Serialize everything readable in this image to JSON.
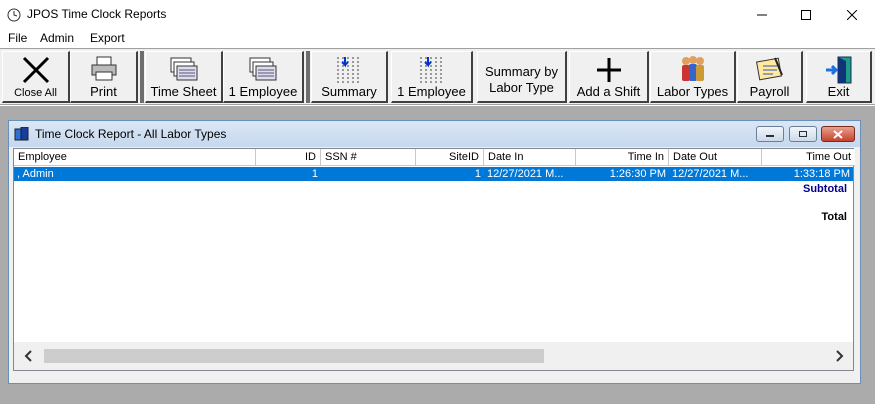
{
  "window": {
    "title": "JPOS Time Clock Reports"
  },
  "menu": [
    "File",
    "Admin",
    "Export"
  ],
  "toolbar": {
    "close_all": "Close All",
    "print": "Print",
    "time_sheet": "Time Sheet",
    "one_employee_a": "1 Employee",
    "summary": "Summary",
    "one_employee_b": "1 Employee",
    "summary_by_labor_type": "Summary by\nLabor Type",
    "add_shift": "Add a Shift",
    "labor_types": "Labor Types",
    "payroll": "Payroll",
    "exit": "Exit"
  },
  "report": {
    "title": "Time Clock Report - All Labor Types",
    "columns": [
      "Employee",
      "ID",
      "SSN #",
      "SiteID",
      "Date In",
      "Time In",
      "Date Out",
      "Time Out"
    ],
    "rows": [
      {
        "employee": ", Admin",
        "id": "1",
        "ssn": "",
        "site_id": "1",
        "date_in": "12/27/2021 M...",
        "time_in": "1:26:30 PM",
        "date_out": "12/27/2021 M...",
        "time_out": "1:33:18 PM"
      }
    ],
    "subtotal_label": "Subtotal",
    "total_label": "Total"
  },
  "colors": {
    "selection": "#0078d7",
    "subtotal": "#00008b",
    "workspace": "#ababab"
  }
}
